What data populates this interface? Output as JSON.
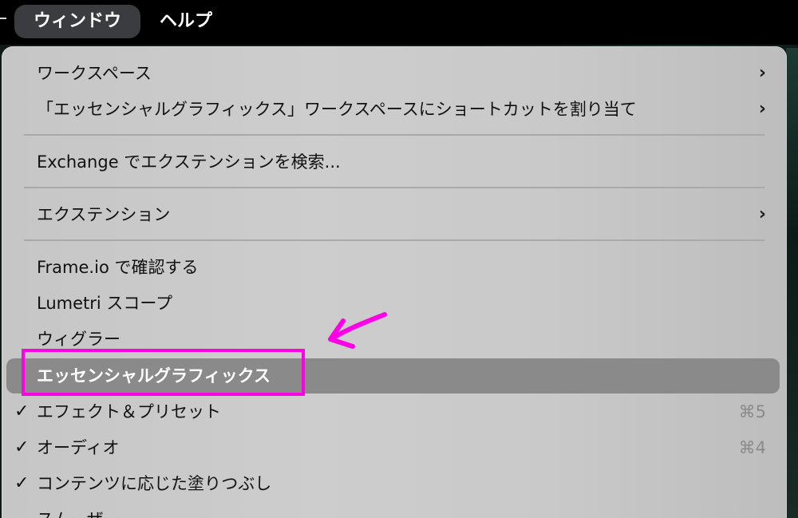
{
  "menubar": {
    "active_menu": "ウィンドウ",
    "next_menu": "ヘルプ"
  },
  "menu": {
    "items": [
      {
        "label": "ワークスペース",
        "submenu": true
      },
      {
        "label": "「エッセンシャルグラフィックス」ワークスペースにショートカットを割り当て",
        "submenu": true
      },
      {
        "label": "Exchange でエクステンションを検索..."
      },
      {
        "label": "エクステンション",
        "submenu": true
      },
      {
        "label": "Frame.io で確認する"
      },
      {
        "label": "Lumetri スコープ"
      },
      {
        "label": "ウィグラー"
      },
      {
        "label": "エッセンシャルグラフィックス",
        "highlighted": true
      },
      {
        "label": "エフェクト＆プリセット",
        "checked": true,
        "shortcut": "⌘5"
      },
      {
        "label": "オーディオ",
        "checked": true,
        "shortcut": "⌘4"
      },
      {
        "label": "コンテンツに応じた塗りつぶし",
        "checked": true
      },
      {
        "label": "スムーザー"
      }
    ],
    "chevron_glyph": "›",
    "check_glyph": "✓"
  },
  "annotation": {
    "box_color": "#ff00e6",
    "arrow_color": "#ff00e6"
  }
}
